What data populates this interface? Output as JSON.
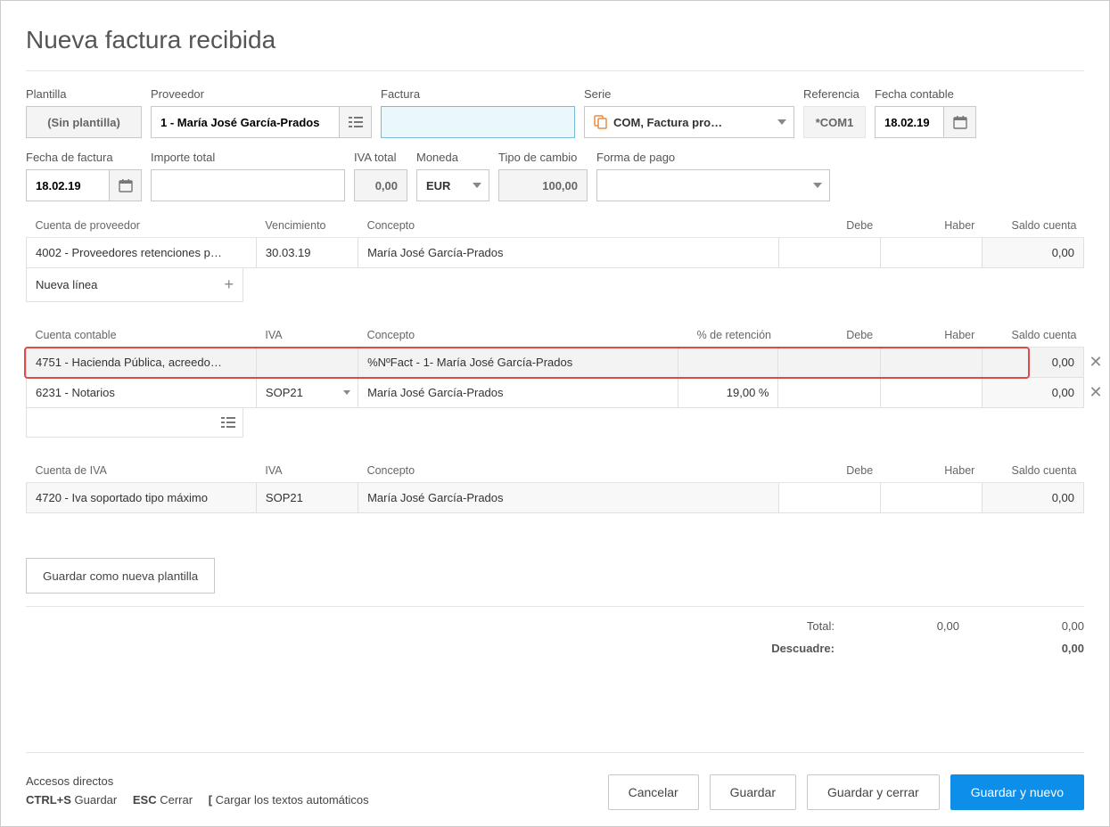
{
  "title": "Nueva factura recibida",
  "labels": {
    "plantilla": "Plantilla",
    "proveedor": "Proveedor",
    "factura": "Factura",
    "serie": "Serie",
    "referencia": "Referencia",
    "fecha_contable": "Fecha contable",
    "fecha_factura": "Fecha de factura",
    "importe_total": "Importe total",
    "iva_total": "IVA total",
    "moneda": "Moneda",
    "tipo_cambio": "Tipo de cambio",
    "forma_pago": "Forma de pago"
  },
  "values": {
    "plantilla": "(Sin plantilla)",
    "proveedor": "1 - María José García-Prados",
    "factura": "",
    "serie": "COM, Factura pro…",
    "referencia": "*COM1",
    "fecha_contable": "18.02.19",
    "fecha_factura": "18.02.19",
    "importe_total": "",
    "iva_total": "0,00",
    "moneda": "EUR",
    "tipo_cambio": "100,00",
    "forma_pago": ""
  },
  "grid1": {
    "headers": [
      "Cuenta de proveedor",
      "Vencimiento",
      "Concepto",
      "Debe",
      "Haber",
      "Saldo cuenta"
    ],
    "row": {
      "cuenta": "4002 - Proveedores retenciones p…",
      "vencimiento": "30.03.19",
      "concepto": "María José García-Prados",
      "debe": "",
      "haber": "",
      "saldo": "0,00"
    },
    "new_line": "Nueva línea"
  },
  "grid2": {
    "headers": [
      "Cuenta contable",
      "IVA",
      "Concepto",
      "% de retención",
      "Debe",
      "Haber",
      "Saldo cuenta"
    ],
    "rows": [
      {
        "cuenta": "4751 - Hacienda Pública, acreedo…",
        "iva": "",
        "concepto": "%NºFact - 1- María José García-Prados",
        "ret": "",
        "debe": "",
        "haber": "",
        "saldo": "0,00",
        "highlighted": true
      },
      {
        "cuenta": "6231 - Notarios",
        "iva": "SOP21",
        "concepto": "María José García-Prados",
        "ret": "19,00 %",
        "debe": "",
        "haber": "",
        "saldo": "0,00",
        "highlighted": false
      }
    ]
  },
  "grid3": {
    "headers": [
      "Cuenta de IVA",
      "IVA",
      "Concepto",
      "Debe",
      "Haber",
      "Saldo cuenta"
    ],
    "row": {
      "cuenta": "4720 - Iva soportado tipo máximo",
      "iva": "SOP21",
      "concepto": "María José García-Prados",
      "debe": "",
      "haber": "",
      "saldo": "0,00"
    }
  },
  "tpl_button": "Guardar como nueva plantilla",
  "totals": {
    "total_label": "Total:",
    "total_debe": "0,00",
    "total_haber": "0,00",
    "descuadre_label": "Descuadre:",
    "descuadre": "0,00"
  },
  "shortcuts": {
    "title": "Accesos directos",
    "save_key": "CTRL+S",
    "save_text": "Guardar",
    "esc_key": "ESC",
    "esc_text": "Cerrar",
    "brk_key": "[",
    "brk_text": "Cargar los textos automáticos"
  },
  "buttons": {
    "cancel": "Cancelar",
    "save": "Guardar",
    "save_close": "Guardar y cerrar",
    "save_new": "Guardar y nuevo"
  }
}
